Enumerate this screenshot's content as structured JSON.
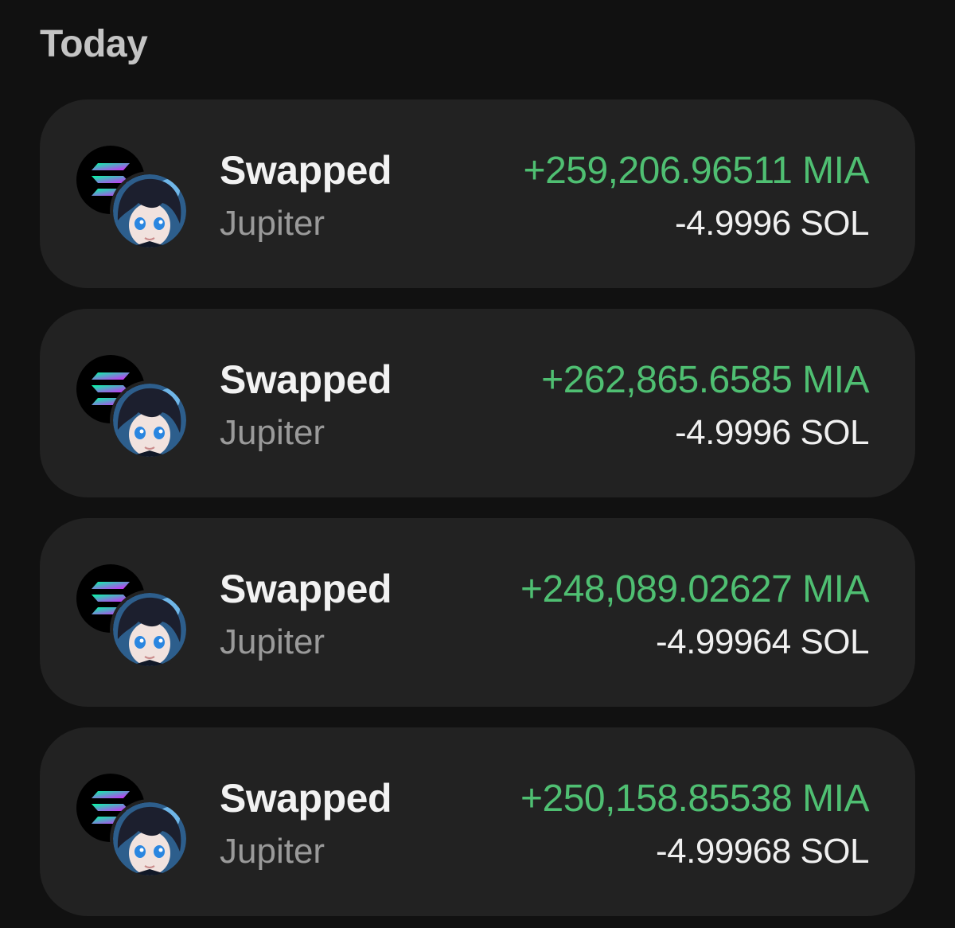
{
  "section": {
    "title": "Today"
  },
  "icons": {
    "token_a": "solana-icon",
    "token_b": "mia-token-avatar"
  },
  "colors": {
    "background": "#111111",
    "card": "#222222",
    "received": "#4fbf72",
    "sent": "#f0f0f0",
    "subtitle": "#9a9a9a"
  },
  "transactions": [
    {
      "type": "Swapped",
      "platform": "Jupiter",
      "received": "+259,206.96511 MIA",
      "sent": "-4.9996 SOL"
    },
    {
      "type": "Swapped",
      "platform": "Jupiter",
      "received": "+262,865.6585 MIA",
      "sent": "-4.9996 SOL"
    },
    {
      "type": "Swapped",
      "platform": "Jupiter",
      "received": "+248,089.02627 MIA",
      "sent": "-4.99964 SOL"
    },
    {
      "type": "Swapped",
      "platform": "Jupiter",
      "received": "+250,158.85538 MIA",
      "sent": "-4.99968 SOL"
    }
  ]
}
